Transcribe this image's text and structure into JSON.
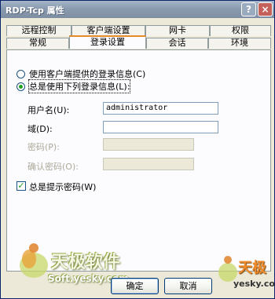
{
  "window": {
    "title": "RDP-Tcp 属性",
    "help_glyph": "?",
    "close_glyph": "×"
  },
  "tabs": {
    "row_back": [
      "远程控制",
      "客户端设置",
      "网卡",
      "权限"
    ],
    "row_front": [
      "常规",
      "登录设置",
      "会话",
      "环境"
    ],
    "selected": "登录设置"
  },
  "logon": {
    "option_client": "使用客户端提供的登录信息(C)",
    "option_always": "总是使用下列登录信息(L):",
    "selected_option": "always",
    "username_label": "用户名(U):",
    "username_value": "administrator",
    "domain_label": "域(D):",
    "domain_value": "",
    "password_label": "密码(P):",
    "password_value": "",
    "confirm_label": "确认密码(O):",
    "confirm_value": "",
    "prompt_label": "总是提示密码(W)",
    "prompt_checked": true
  },
  "buttons": {
    "ok": "确定",
    "cancel": "取消"
  },
  "watermarks": {
    "left_brand": "天极软件",
    "left_url": "Soft.yesky.com",
    "right_brand": "天极",
    "right_url": "yesky.com"
  },
  "colors": {
    "selected_tab_accent": "#e68b2c",
    "radio_dot": "#21a121",
    "close_button": "#c3615a"
  }
}
